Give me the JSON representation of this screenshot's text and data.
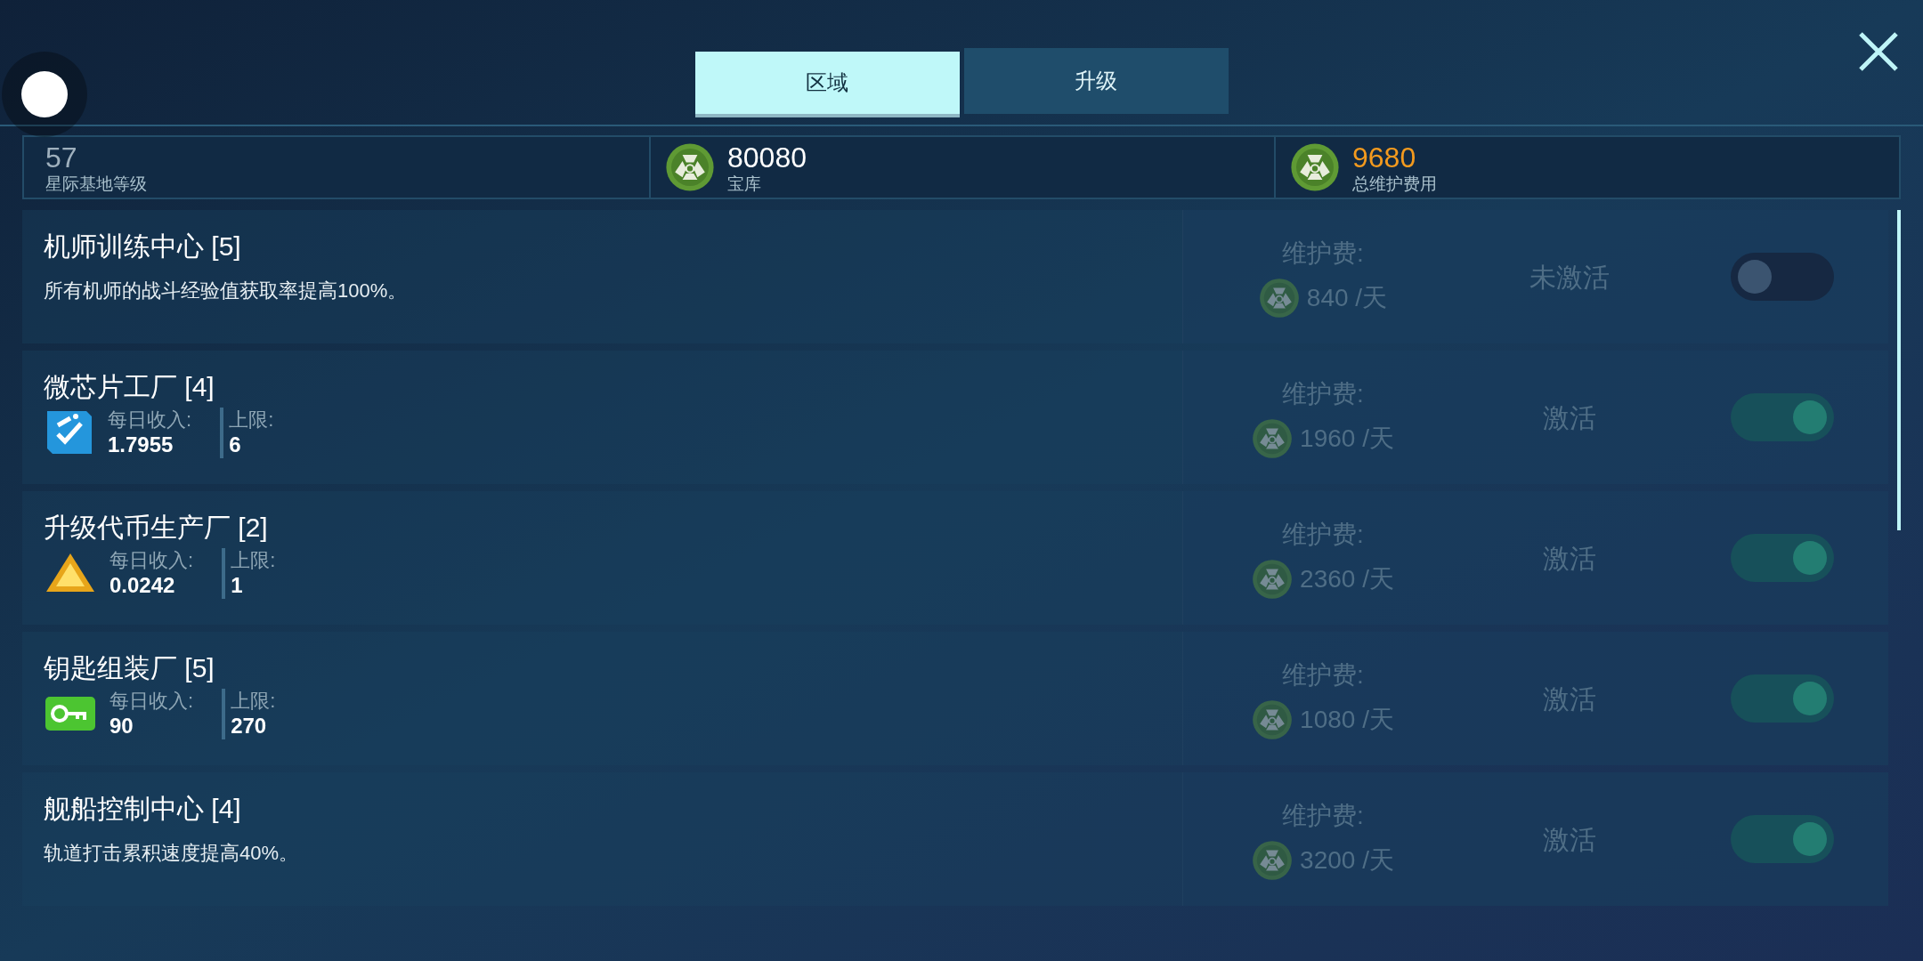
{
  "tabs": [
    {
      "label": "区域",
      "selected": true
    },
    {
      "label": "升级",
      "selected": false
    }
  ],
  "stats": [
    {
      "kind": "level",
      "value": "57",
      "label": "星际基地等级"
    },
    {
      "kind": "coin",
      "value": "80080",
      "label": "宝库",
      "highlight": false
    },
    {
      "kind": "coin",
      "value": "9680",
      "label": "总维护费用",
      "highlight": true
    }
  ],
  "rows": [
    {
      "kind": "effect",
      "title": "机师训练中心 [5]",
      "description": "所有机师的战斗经验值获取率提高100%。",
      "cost_label": "维护费:",
      "cost": "840 /天",
      "status": "未激活",
      "on": false
    },
    {
      "kind": "production",
      "title": "微芯片工厂 [4]",
      "resource": {
        "kind": "chip"
      },
      "income_label": "每日收入:",
      "income": "1.7955",
      "limit_label": "上限:",
      "limit": "6",
      "cost_label": "维护费:",
      "cost": "1960 /天",
      "status": "激活",
      "on": true
    },
    {
      "kind": "production",
      "title": "升级代币生产厂 [2]",
      "resource": {
        "kind": "token"
      },
      "income_label": "每日收入:",
      "income": "0.0242",
      "limit_label": "上限:",
      "limit": "1",
      "cost_label": "维护费:",
      "cost": "2360 /天",
      "status": "激活",
      "on": true
    },
    {
      "kind": "production",
      "title": "钥匙组装厂 [5]",
      "resource": {
        "kind": "key"
      },
      "income_label": "每日收入:",
      "income": "90",
      "limit_label": "上限:",
      "limit": "270",
      "cost_label": "维护费:",
      "cost": "1080 /天",
      "status": "激活",
      "on": true
    },
    {
      "kind": "effect",
      "title": "舰船控制中心 [4]",
      "description": "轨道打击累积速度提高40%。",
      "cost_label": "维护费:",
      "cost": "3200 /天",
      "status": "激活",
      "on": true
    }
  ]
}
